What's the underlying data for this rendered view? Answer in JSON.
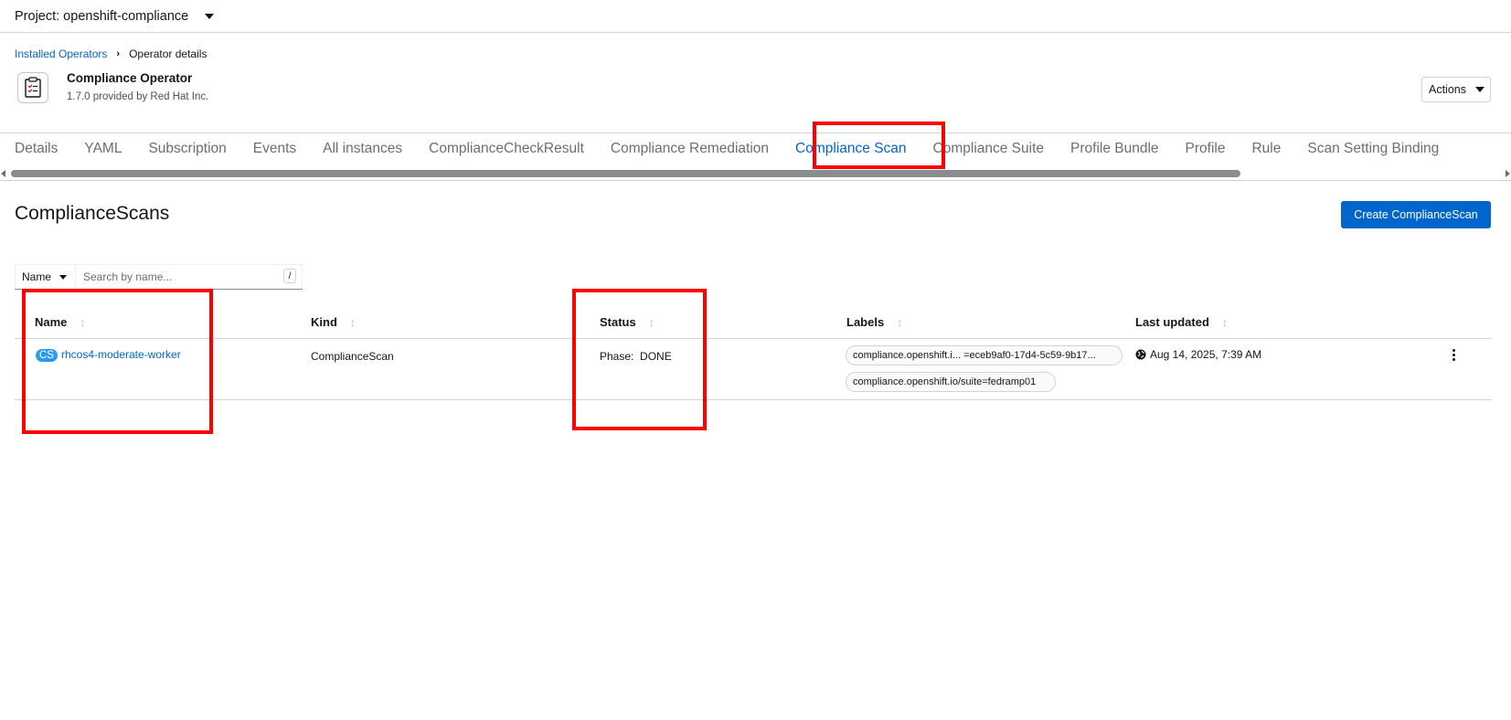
{
  "project_bar": {
    "label": "Project: openshift-compliance"
  },
  "breadcrumb": {
    "link": "Installed Operators",
    "current": "Operator details"
  },
  "operator": {
    "name": "Compliance Operator",
    "subtitle": "1.7.0 provided by Red Hat Inc."
  },
  "actions": {
    "label": "Actions"
  },
  "tabs": [
    {
      "label": "Details",
      "active": false
    },
    {
      "label": "YAML",
      "active": false
    },
    {
      "label": "Subscription",
      "active": false
    },
    {
      "label": "Events",
      "active": false
    },
    {
      "label": "All instances",
      "active": false
    },
    {
      "label": "ComplianceCheckResult",
      "active": false
    },
    {
      "label": "Compliance Remediation",
      "active": false
    },
    {
      "label": "Compliance Scan",
      "active": true
    },
    {
      "label": "Compliance Suite",
      "active": false
    },
    {
      "label": "Profile Bundle",
      "active": false
    },
    {
      "label": "Profile",
      "active": false
    },
    {
      "label": "Rule",
      "active": false
    },
    {
      "label": "Scan Setting Binding",
      "active": false
    }
  ],
  "page": {
    "heading": "ComplianceScans",
    "create_button": "Create ComplianceScan"
  },
  "filter": {
    "select_value": "Name",
    "placeholder": "Search by name...",
    "shortcut": "/"
  },
  "table": {
    "headers": [
      "Name",
      "Kind",
      "Status",
      "Labels",
      "Last updated"
    ],
    "rows": [
      {
        "badge": "CS",
        "name": "rhcos4-moderate-worker",
        "kind": "ComplianceScan",
        "status": "Phase:  DONE",
        "labels": [
          "compliance.openshift.i...  =eceb9af0-17d4-5c59-9b17...",
          "compliance.openshift.io/suite=fedramp01"
        ],
        "last_updated": "Aug 14, 2025, 7:39 AM"
      }
    ]
  },
  "colors": {
    "accent": "#0066cc",
    "highlight": "#ff0000",
    "badge": "#2b9af3"
  },
  "icons": [
    "caret-down-icon",
    "operator-document-icon",
    "sort-icon",
    "globe-icon",
    "kebab-icon"
  ]
}
